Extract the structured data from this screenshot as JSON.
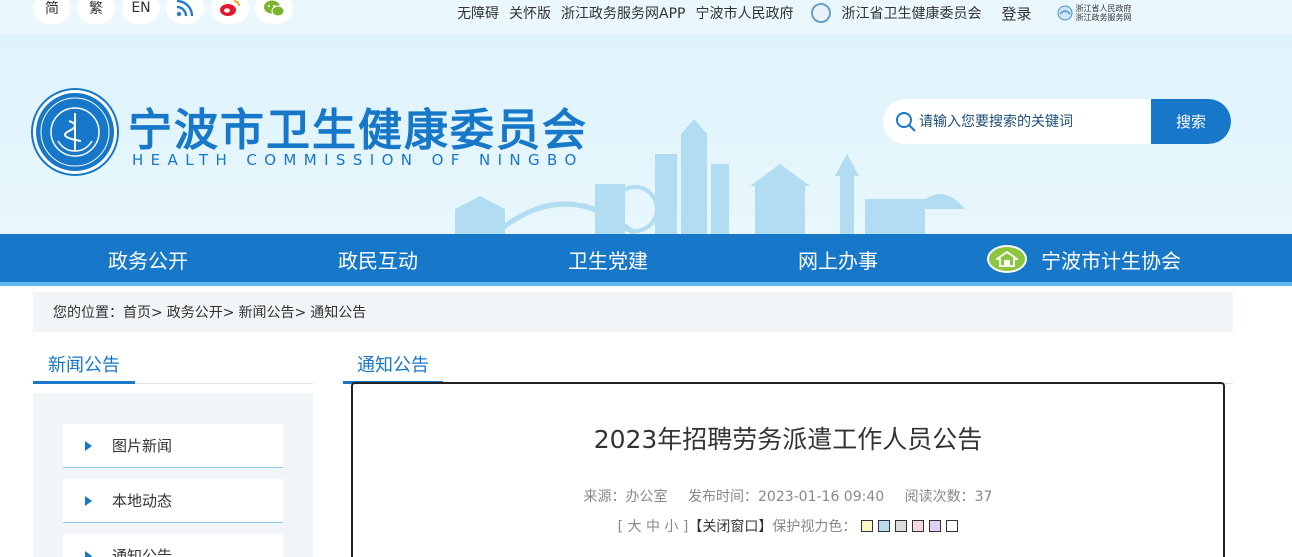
{
  "topbar": {
    "lang": [
      "简",
      "繁",
      "EN"
    ],
    "links": [
      "无障碍",
      "关怀版",
      "浙江政务服务网APP",
      "宁波市人民政府"
    ],
    "provincial_link": "浙江省卫生健康委员会",
    "login": "登录",
    "gov_logo_line1": "浙江省人民政府",
    "gov_logo_line2": "浙江政务服务网"
  },
  "header": {
    "title": "宁波市卫生健康委员会",
    "subtitle": "HEALTH COMMISSION OF NINGBO",
    "search_placeholder": "请输入您要搜索的关键词",
    "search_button": "搜索"
  },
  "nav": {
    "items": [
      "政务公开",
      "政民互动",
      "卫生党建",
      "网上办事"
    ],
    "association": "宁波市计生协会"
  },
  "breadcrumb": {
    "prefix": "您的位置：",
    "items": [
      "首页>",
      "政务公开>",
      "新闻公告>",
      "通知公告"
    ]
  },
  "sidebar": {
    "title": "新闻公告",
    "items": [
      "图片新闻",
      "本地动态",
      "通知公告"
    ]
  },
  "main": {
    "tab": "通知公告",
    "article_title": "2023年招聘劳务派遣工作人员公告",
    "source": "来源：办公室",
    "publish_time": "发布时间：2023-01-16 09:40",
    "read_count": "阅读次数：37",
    "font_size_label": "[ 大 中 小 ]",
    "close_window": "【关闭窗口】",
    "eye_care_label": "保护视力色：",
    "eye_care_colors": [
      "#fdf8c8",
      "#b8dbf0",
      "#dcdcdc",
      "#f5d7e2",
      "#e0d0f5",
      "#ffffff"
    ]
  },
  "colors": {
    "brand": "#1777c8",
    "accent_green": "#8cc63f"
  }
}
